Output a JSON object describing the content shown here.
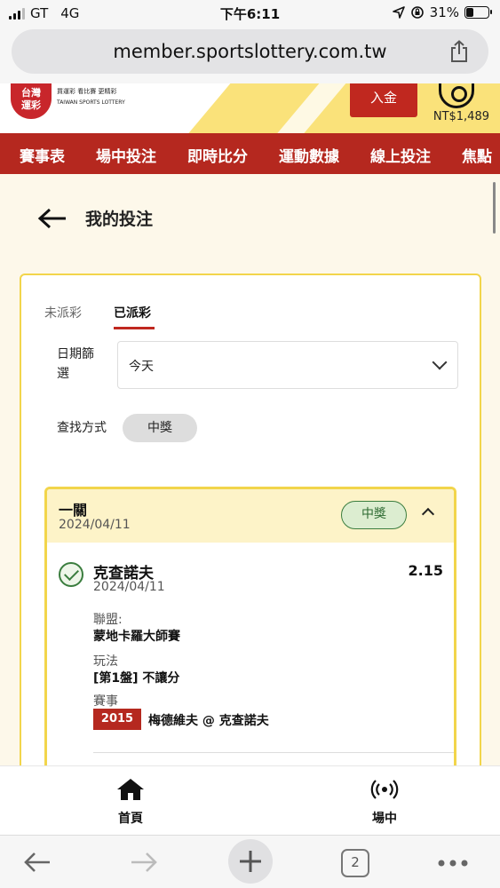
{
  "status_bar": {
    "carrier": "GT",
    "network": "4G",
    "time": "下午6:11",
    "battery": "31%",
    "battery_level": 0.31
  },
  "browser": {
    "url": "member.sportslottery.com.tw",
    "tab_count": "2",
    "icons": [
      "share-icon",
      "back-icon",
      "forward-icon",
      "plus-icon",
      "tabs-icon",
      "more-icon"
    ]
  },
  "site_header": {
    "logo_text": "台灣運彩",
    "logo_slogans": "買運彩 看比賽 更精彩",
    "logo_english": "TAIWAN SPORTS LOTTERY",
    "deposit_label": "入金",
    "balance": "NT$1,489"
  },
  "nav": {
    "items": [
      "賽事表",
      "場中投注",
      "即時比分",
      "運動數據",
      "線上投注",
      "焦點"
    ]
  },
  "page": {
    "title": "我的投注"
  },
  "tabs": {
    "unsettled": "未派彩",
    "settled": "已派彩"
  },
  "filter": {
    "date_label": "日期篩選",
    "date_value": "今天",
    "search_label": "查找方式",
    "search_chip": "中獎"
  },
  "bet": {
    "type": "一關",
    "date": "2024/04/11",
    "status": "中獎",
    "selection": {
      "player": "克查諾夫",
      "date": "2024/04/11",
      "odds": "2.15",
      "league_label": "聯盟:",
      "league": "蒙地卡羅大師賽",
      "market_label": "玩法",
      "market": "[第1盤] 不讓分",
      "event_label": "賽事",
      "event_number": "2015",
      "event_name": "梅德維夫 @ 克查諾夫"
    }
  },
  "bottom_tabs": {
    "home": "首頁",
    "live": "場中"
  },
  "colors": {
    "brand_red": "#b5281f",
    "accent_yellow": "#f2d54b",
    "win_green": "#3a7d3e",
    "page_bg": "#fdf8ea"
  }
}
